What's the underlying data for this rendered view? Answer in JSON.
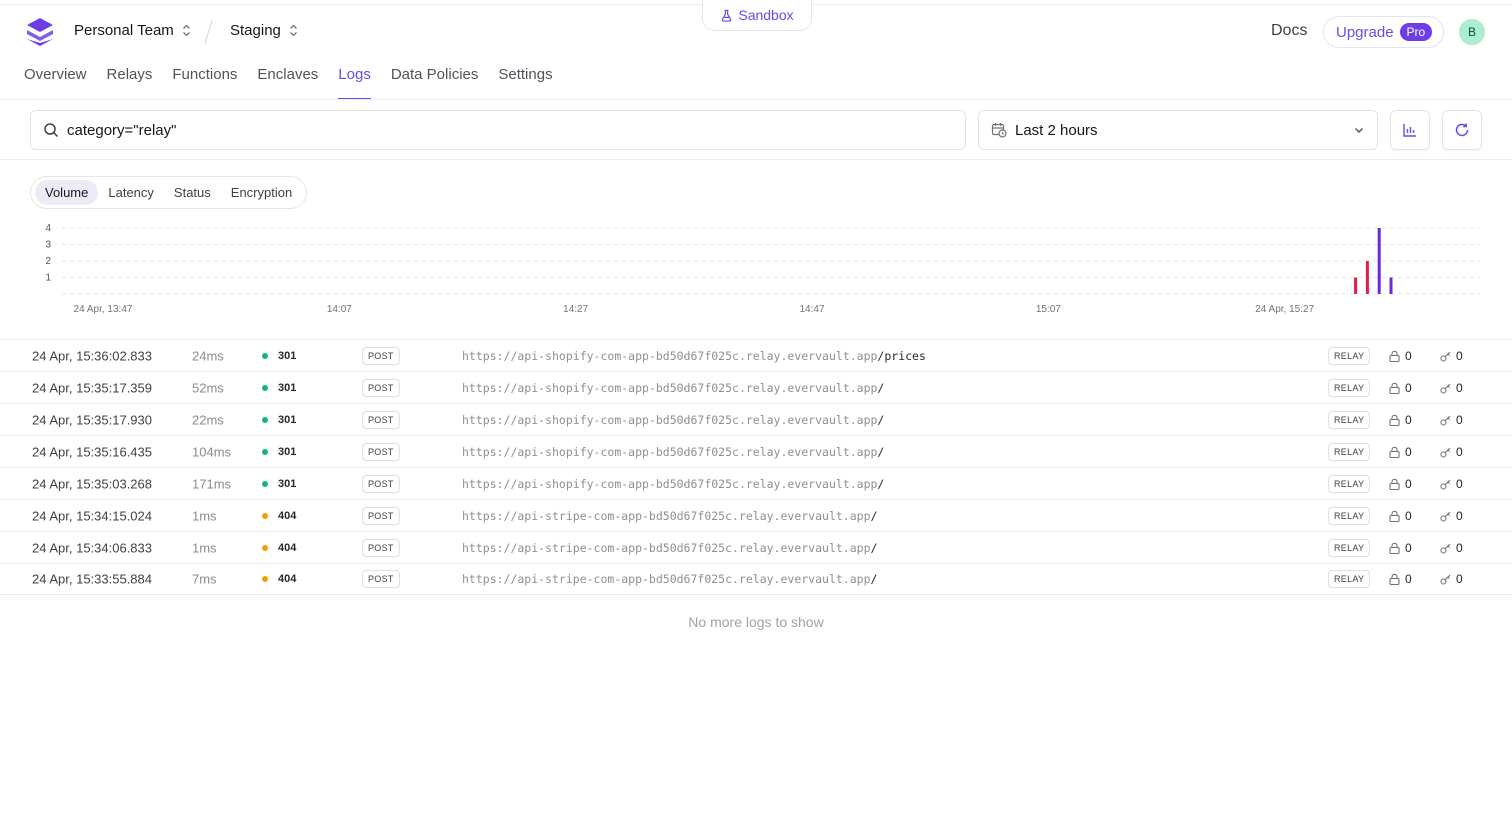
{
  "sandbox": {
    "label": "Sandbox"
  },
  "header": {
    "team": "Personal Team",
    "environment": "Staging",
    "docs": "Docs",
    "upgrade": "Upgrade",
    "pro_badge": "Pro",
    "avatar_initial": "B"
  },
  "nav": {
    "tabs": [
      {
        "label": "Overview"
      },
      {
        "label": "Relays"
      },
      {
        "label": "Functions"
      },
      {
        "label": "Enclaves"
      },
      {
        "label": "Logs",
        "active": true
      },
      {
        "label": "Data Policies"
      },
      {
        "label": "Settings"
      }
    ]
  },
  "toolbar": {
    "search_value": "category=\"relay\"",
    "time_range": "Last 2 hours"
  },
  "metric_tabs": [
    {
      "label": "Volume",
      "active": true
    },
    {
      "label": "Latency"
    },
    {
      "label": "Status"
    },
    {
      "label": "Encryption"
    }
  ],
  "chart_data": {
    "type": "bar",
    "y_ticks": [
      "1",
      "2",
      "3",
      "4"
    ],
    "ylim": [
      0,
      4
    ],
    "x_ticks": [
      "24 Apr, 13:47",
      "14:07",
      "14:27",
      "14:47",
      "15:07",
      "24 Apr, 15:27"
    ],
    "x_start_minutes": 0,
    "x_end_minutes": 120,
    "bars": [
      {
        "time": "15:33",
        "minute": 106,
        "value": 1,
        "color": "#e11d48"
      },
      {
        "time": "15:34",
        "minute": 107,
        "value": 2,
        "color": "#e11d48"
      },
      {
        "time": "15:35",
        "minute": 108,
        "value": 4,
        "color": "#6d28d9"
      },
      {
        "time": "15:36",
        "minute": 109,
        "value": 1,
        "color": "#6d28d9"
      }
    ],
    "grid": true
  },
  "colors": {
    "accent": "#6d4ae6",
    "ok": "#10b981",
    "warn": "#f59e0b"
  },
  "logs": [
    {
      "time": "24 Apr, 15:36:02.833",
      "duration": "24ms",
      "status": "301",
      "status_color": "#10b981",
      "method": "POST",
      "url_host": "https://api-shopify-com-app-bd50d67f025c.relay.evervault.app",
      "url_path": "/prices",
      "category": "RELAY",
      "encrypted": "0",
      "decrypted": "0"
    },
    {
      "time": "24 Apr, 15:35:17.359",
      "duration": "52ms",
      "status": "301",
      "status_color": "#10b981",
      "method": "POST",
      "url_host": "https://api-shopify-com-app-bd50d67f025c.relay.evervault.app",
      "url_path": "/",
      "category": "RELAY",
      "encrypted": "0",
      "decrypted": "0"
    },
    {
      "time": "24 Apr, 15:35:17.930",
      "duration": "22ms",
      "status": "301",
      "status_color": "#10b981",
      "method": "POST",
      "url_host": "https://api-shopify-com-app-bd50d67f025c.relay.evervault.app",
      "url_path": "/",
      "category": "RELAY",
      "encrypted": "0",
      "decrypted": "0"
    },
    {
      "time": "24 Apr, 15:35:16.435",
      "duration": "104ms",
      "status": "301",
      "status_color": "#10b981",
      "method": "POST",
      "url_host": "https://api-shopify-com-app-bd50d67f025c.relay.evervault.app",
      "url_path": "/",
      "category": "RELAY",
      "encrypted": "0",
      "decrypted": "0"
    },
    {
      "time": "24 Apr, 15:35:03.268",
      "duration": "171ms",
      "status": "301",
      "status_color": "#10b981",
      "method": "POST",
      "url_host": "https://api-shopify-com-app-bd50d67f025c.relay.evervault.app",
      "url_path": "/",
      "category": "RELAY",
      "encrypted": "0",
      "decrypted": "0"
    },
    {
      "time": "24 Apr, 15:34:15.024",
      "duration": "1ms",
      "status": "404",
      "status_color": "#f59e0b",
      "method": "POST",
      "url_host": "https://api-stripe-com-app-bd50d67f025c.relay.evervault.app",
      "url_path": "/",
      "category": "RELAY",
      "encrypted": "0",
      "decrypted": "0"
    },
    {
      "time": "24 Apr, 15:34:06.833",
      "duration": "1ms",
      "status": "404",
      "status_color": "#f59e0b",
      "method": "POST",
      "url_host": "https://api-stripe-com-app-bd50d67f025c.relay.evervault.app",
      "url_path": "/",
      "category": "RELAY",
      "encrypted": "0",
      "decrypted": "0"
    },
    {
      "time": "24 Apr, 15:33:55.884",
      "duration": "7ms",
      "status": "404",
      "status_color": "#f59e0b",
      "method": "POST",
      "url_host": "https://api-stripe-com-app-bd50d67f025c.relay.evervault.app",
      "url_path": "/",
      "category": "RELAY",
      "encrypted": "0",
      "decrypted": "0"
    }
  ],
  "footer": {
    "no_more": "No more logs to show"
  }
}
